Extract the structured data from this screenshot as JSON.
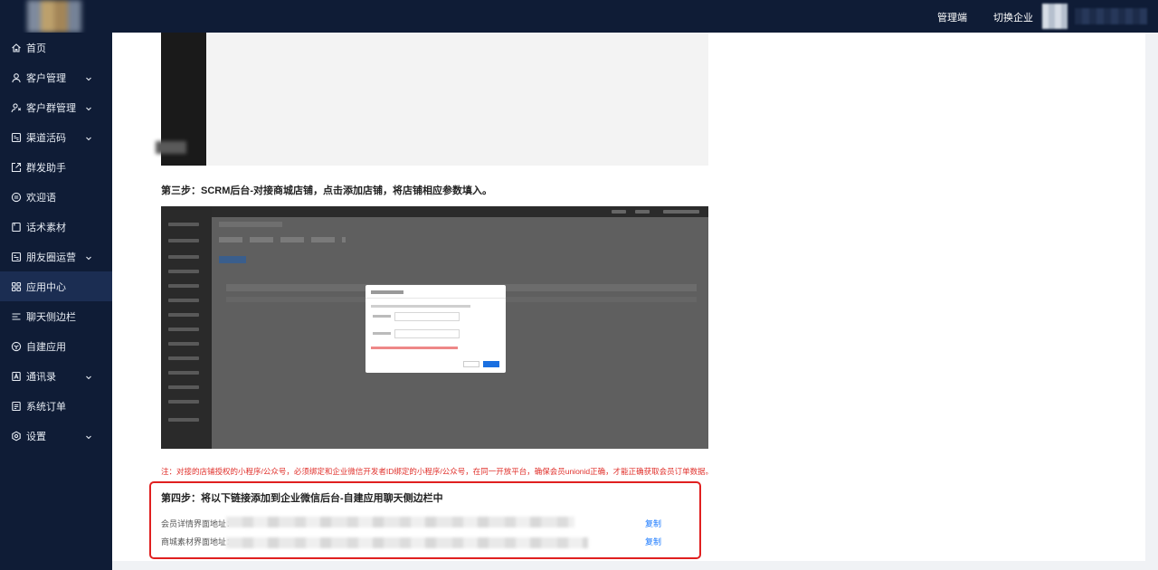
{
  "header": {
    "admin_label": "管理端",
    "switch_label": "切换企业"
  },
  "sidebar": {
    "items": [
      {
        "label": "首页",
        "icon": "home-icon",
        "has_children": false
      },
      {
        "label": "客户管理",
        "icon": "user-icon",
        "has_children": true
      },
      {
        "label": "客户群管理",
        "icon": "group-icon",
        "has_children": true
      },
      {
        "label": "渠道活码",
        "icon": "qrcode-icon",
        "has_children": true
      },
      {
        "label": "群发助手",
        "icon": "share-icon",
        "has_children": false
      },
      {
        "label": "欢迎语",
        "icon": "chat-icon",
        "has_children": false
      },
      {
        "label": "话术素材",
        "icon": "book-icon",
        "has_children": false
      },
      {
        "label": "朋友圈运营",
        "icon": "moments-icon",
        "has_children": true
      },
      {
        "label": "应用中心",
        "icon": "apps-icon",
        "has_children": false,
        "active": true
      },
      {
        "label": "聊天侧边栏",
        "icon": "list-icon",
        "has_children": false
      },
      {
        "label": "自建应用",
        "icon": "cube-icon",
        "has_children": false
      },
      {
        "label": "通讯录",
        "icon": "contacts-icon",
        "has_children": true
      },
      {
        "label": "系统订单",
        "icon": "order-icon",
        "has_children": false
      },
      {
        "label": "设置",
        "icon": "gear-icon",
        "has_children": true
      }
    ]
  },
  "main": {
    "step3_text": "第三步：SCRM后台-对接商城店铺，点击添加店铺，将店铺相应参数填入。",
    "note_text": "注：对接的店铺授权的小程序/公众号，必须绑定和企业微信开发者ID绑定的小程序/公众号，在同一开放平台，确保会员unionid正确，才能正确获取会员订单数据。",
    "step4_title": "第四步：将以下链接添加到企业微信后台-自建应用聊天侧边栏中",
    "links": [
      {
        "label": "会员详情界面地址：",
        "copy_label": "复制"
      },
      {
        "label": "商城素材界面地址：",
        "copy_label": "复制"
      }
    ]
  },
  "colors": {
    "sidebar_bg": "#0f1c36",
    "accent": "#1677ff",
    "warning": "#e0302b"
  }
}
